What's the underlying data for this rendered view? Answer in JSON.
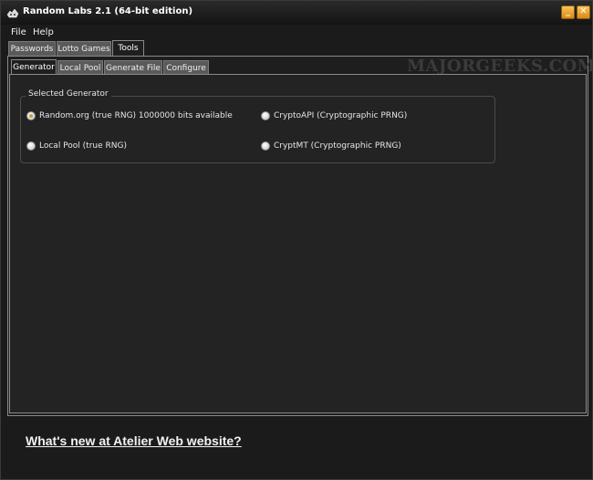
{
  "window": {
    "title": "Random Labs 2.1 (64-bit edition)"
  },
  "menu": {
    "file": "File",
    "help": "Help"
  },
  "main_tabs": [
    "Passwords",
    "Lotto Games",
    "Tools"
  ],
  "tool_tabs": [
    "Generator",
    "Local Pool",
    "Generate File",
    "Configure"
  ],
  "watermark": "MAJORGEEKS.COM",
  "generator": {
    "group_label": "Selected Generator",
    "options": [
      {
        "label": "Random.org (true RNG) 1000000 bits available",
        "selected": true
      },
      {
        "label": "CryptoAPI (Cryptographic PRNG)",
        "selected": false
      },
      {
        "label": "Local Pool (true RNG)",
        "selected": false
      },
      {
        "label": "CryptMT  (Cryptographic PRNG)",
        "selected": false
      }
    ]
  },
  "footer": {
    "link_text": "What's new at Atelier Web website?"
  },
  "colors": {
    "accent_button": "#e8a22a",
    "background": "#1b1b1b",
    "tab_inactive": "#5a5a5a"
  }
}
